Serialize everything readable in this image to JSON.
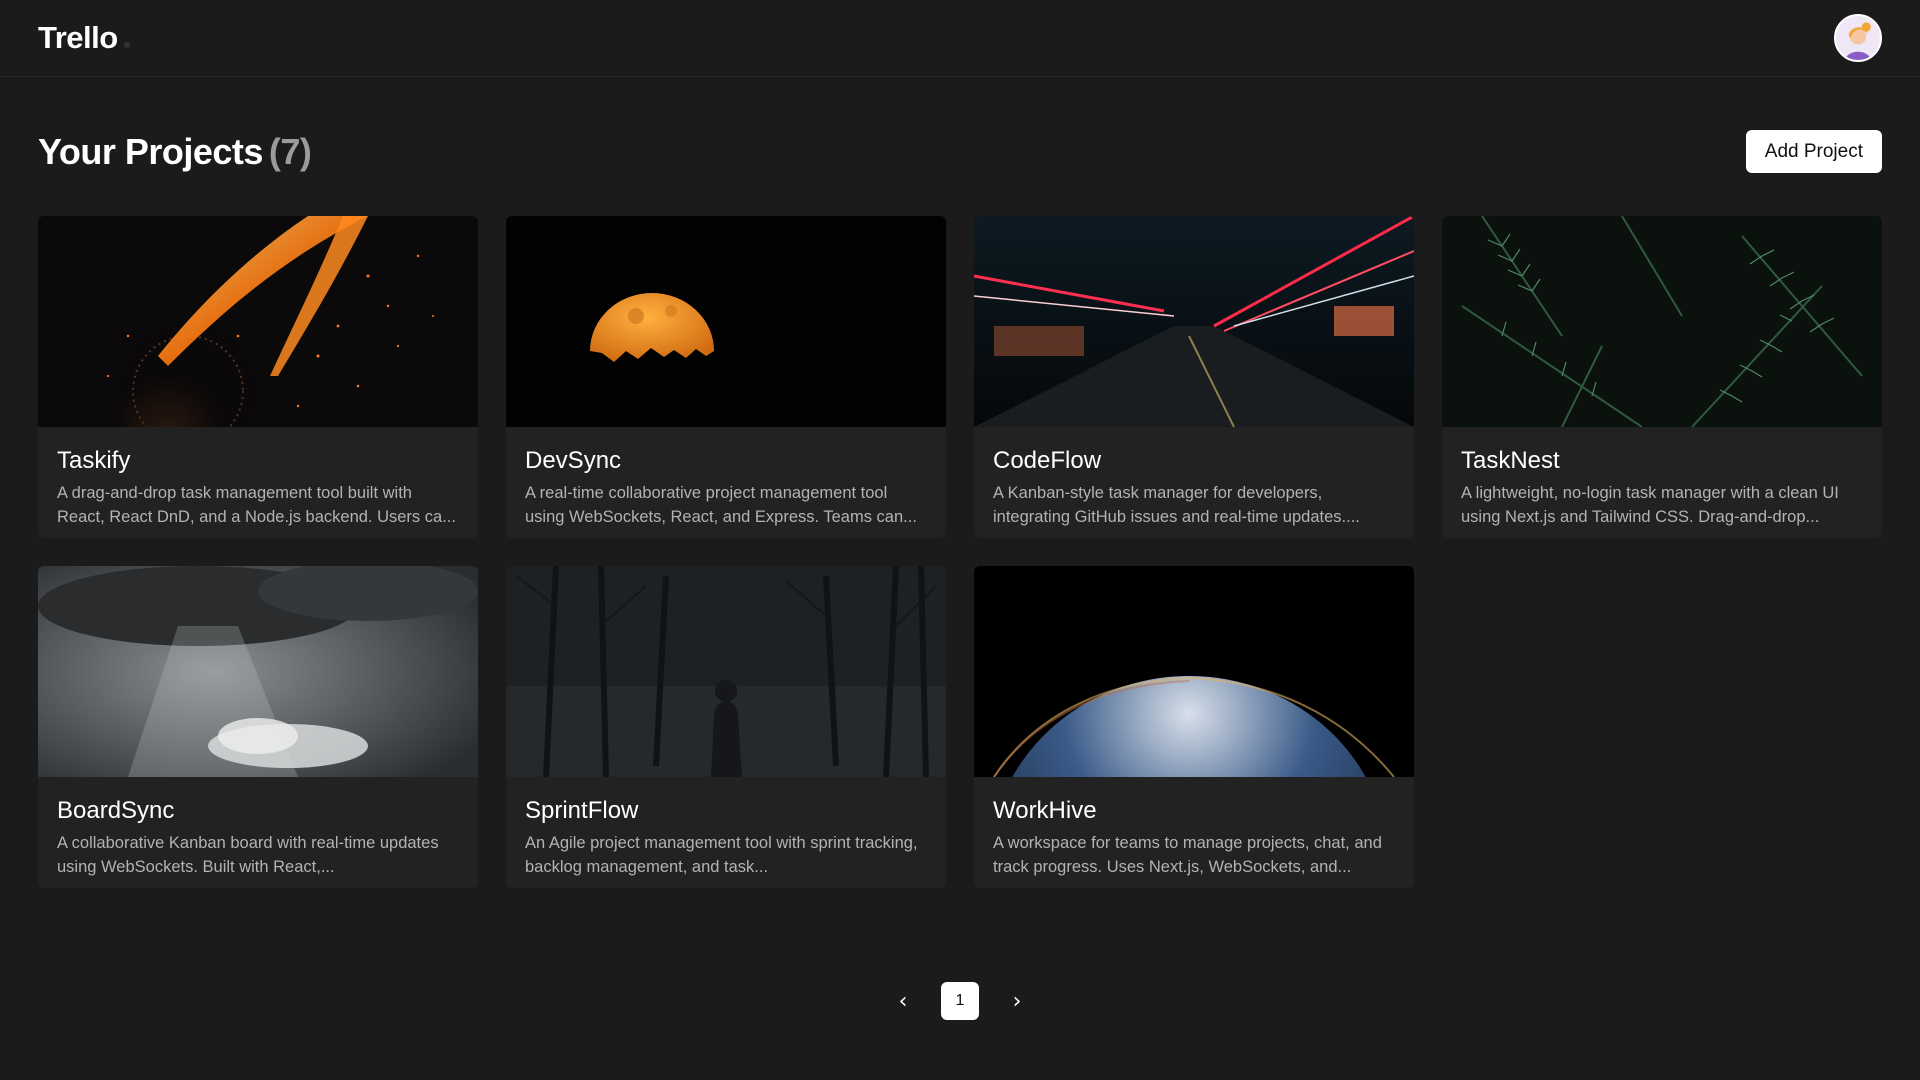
{
  "app": {
    "brand": "Trello"
  },
  "header": {
    "title": "Your Projects",
    "count": "(7)",
    "add_button": "Add Project"
  },
  "projects": [
    {
      "title": "Taskify",
      "description": "A drag-and-drop task management tool built with React, React DnD, and a Node.js backend. Users ca..."
    },
    {
      "title": "DevSync",
      "description": "A real-time collaborative project management tool using WebSockets, React, and Express. Teams can..."
    },
    {
      "title": "CodeFlow",
      "description": "A Kanban-style task manager for developers, integrating GitHub issues and real-time updates...."
    },
    {
      "title": "TaskNest",
      "description": "A lightweight, no-login task manager with a clean UI using Next.js and Tailwind CSS. Drag-and-drop..."
    },
    {
      "title": "BoardSync",
      "description": "A collaborative Kanban board with real-time updates using WebSockets. Built with React,..."
    },
    {
      "title": "SprintFlow",
      "description": "An Agile project management tool with sprint tracking, backlog management, and task..."
    },
    {
      "title": "WorkHive",
      "description": "A workspace for teams to manage projects, chat, and track progress. Uses Next.js, WebSockets, and..."
    }
  ],
  "pagination": {
    "current": "1",
    "prev_icon": "chevron-left-icon",
    "next_icon": "chevron-right-icon"
  },
  "colors": {
    "background": "#1b1b1b",
    "card": "#222222",
    "accent": "#ffffff"
  }
}
